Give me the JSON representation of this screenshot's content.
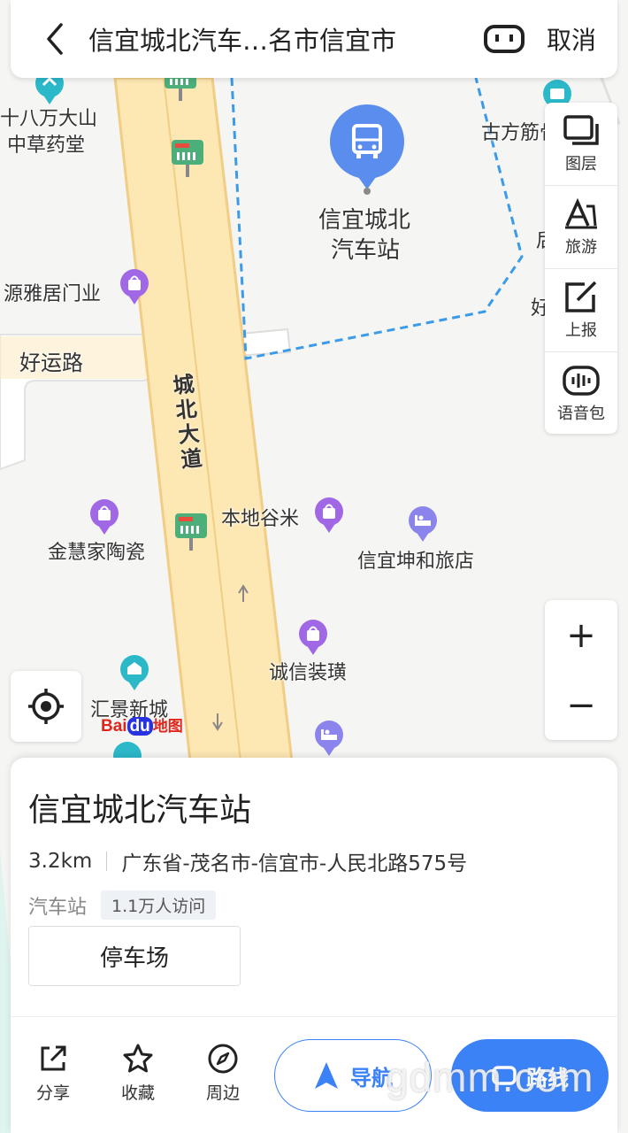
{
  "search": {
    "title": "信宜城北汽车…名市信宜市",
    "cancel_label": "取消"
  },
  "right_tools": [
    {
      "label": "图层",
      "icon": "layers-icon"
    },
    {
      "label": "旅游",
      "icon": "travel-icon"
    },
    {
      "label": "上报",
      "icon": "report-icon"
    },
    {
      "label": "语音包",
      "icon": "voice-pack-icon"
    }
  ],
  "zoom": {
    "in_label": "+",
    "out_label": "−"
  },
  "map": {
    "station_label_line1": "信宜城北",
    "station_label_line2": "汽车站",
    "road_main": "城北大道",
    "road_side": "好运路",
    "pois": {
      "p1_line1": "十八万大山",
      "p1_line2": "中草药堂",
      "p2": "古方筋骨",
      "p3": "源雅居门业",
      "p4": "后",
      "p5": "好",
      "p6": "金慧家陶瓷",
      "p7": "本地谷米",
      "p8": "信宜坤和旅店",
      "p9": "诚信装璜",
      "p10": "汇景新城"
    },
    "logo_bai": "Bai",
    "logo_du": "du",
    "logo_map": "地图"
  },
  "place": {
    "name": "信宜城北汽车站",
    "distance": "3.2km",
    "address": "广东省-茂名市-信宜市-人民北路575号",
    "category": "汽车站",
    "visits": "1.1万人访问",
    "parking_label": "停车场"
  },
  "actions": {
    "share": "分享",
    "favorite": "收藏",
    "nearby": "周边",
    "navigate": "导航",
    "route": "路线"
  },
  "watermark": "gdmm.com",
  "colors": {
    "accent": "#3b82f6",
    "poi_purple": "#a168e6",
    "station_blue": "#5b8def",
    "road_fill": "#fde7b3"
  }
}
